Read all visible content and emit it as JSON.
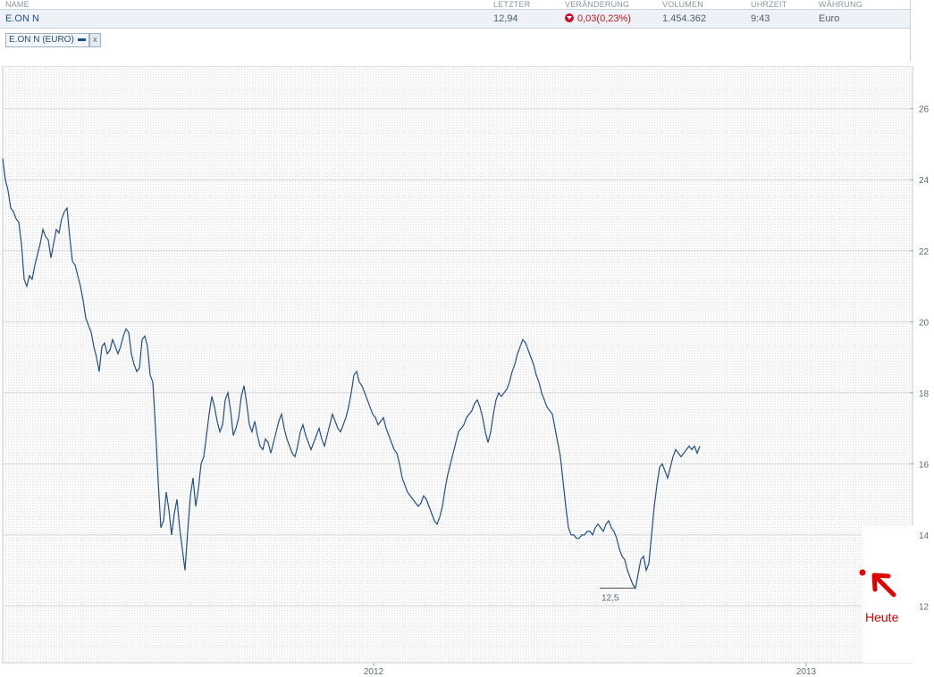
{
  "quote": {
    "headers": {
      "name": "NAME",
      "last": "LETZTER",
      "change": "VERÄNDERUNG",
      "volume": "VOLUMEN",
      "time": "UHRZEIT",
      "currency": "WÄHRUNG"
    },
    "row": {
      "name": "E.ON N",
      "last": "12,94",
      "change": "0,03(0,23%)",
      "volume": "1.454.362",
      "time": "9:43",
      "currency": "Euro"
    },
    "colors": {
      "down": "#c8102e",
      "line": "#1f4f8a"
    }
  },
  "filter": {
    "series_tag": "E.ON N (EURO)",
    "close_symbol": "x"
  },
  "annotation": {
    "text": "Heute"
  },
  "chart_data": {
    "type": "line",
    "y_ticks": [
      "26",
      "24",
      "22",
      "20",
      "18",
      "16",
      "14",
      "12"
    ],
    "x_ticks": [
      "2012",
      "2013"
    ],
    "ylim": [
      10.4,
      27.2
    ],
    "y_min_label": "12,5",
    "series": [
      {
        "x_index": [
          0,
          3,
          6,
          9,
          12,
          15,
          18,
          21,
          24,
          27,
          30,
          33,
          36,
          39,
          42,
          45,
          48,
          51,
          54,
          57,
          60,
          63,
          66,
          69,
          72,
          75,
          78,
          81,
          84,
          87,
          90,
          93,
          96,
          99,
          102,
          105,
          108,
          111,
          114,
          117,
          120,
          123,
          126,
          129,
          132,
          135,
          138,
          141,
          144,
          147,
          150,
          153,
          156,
          159,
          162,
          165,
          168,
          171,
          174,
          177,
          180,
          183,
          186,
          189,
          192,
          195,
          198,
          201,
          204,
          207,
          210,
          213,
          216,
          219,
          222,
          225,
          228,
          231,
          234,
          237,
          240,
          243,
          246,
          249,
          252,
          255,
          258,
          261,
          264,
          267,
          270,
          273,
          276,
          279,
          282,
          285,
          288,
          291,
          294,
          297,
          300,
          303,
          306,
          309,
          312,
          315,
          318,
          321,
          324,
          327,
          330,
          333,
          336,
          339,
          342,
          345,
          348,
          351,
          354,
          357,
          360,
          363,
          366,
          369,
          372,
          375,
          378,
          381,
          384,
          387,
          390,
          393,
          396,
          399,
          402,
          405,
          408,
          411,
          414,
          417,
          420,
          423,
          426,
          429,
          432,
          435,
          438,
          441,
          444,
          447,
          450,
          453,
          456,
          459,
          462,
          465,
          468,
          471,
          474,
          477,
          480,
          483,
          486,
          489,
          492,
          495,
          498,
          501,
          504,
          507,
          510,
          513,
          516,
          519,
          522,
          525,
          528,
          531,
          534,
          537,
          540,
          543,
          546,
          549,
          552,
          555,
          558,
          561,
          564,
          567,
          570,
          573,
          576,
          579,
          582,
          585,
          588,
          591,
          594,
          597,
          600,
          603,
          606,
          609,
          612,
          615,
          618,
          621,
          624,
          627,
          630,
          633,
          636,
          639,
          642,
          645,
          648,
          651,
          654,
          657,
          660,
          663,
          666,
          669,
          672,
          675,
          678,
          681,
          684,
          687,
          690,
          693,
          696,
          699,
          702,
          705,
          708,
          711,
          714,
          717,
          720,
          723,
          726,
          729,
          732,
          735,
          738,
          741,
          744,
          747,
          750,
          753,
          756,
          759,
          762,
          765,
          768,
          771,
          774,
          777,
          780,
          783,
          786,
          789,
          792,
          795,
          798,
          801,
          804,
          807,
          810,
          813,
          816,
          819,
          822,
          825,
          828,
          831,
          834,
          837,
          840,
          843,
          846,
          849,
          852,
          855,
          858,
          861,
          864,
          867,
          870,
          873,
          876,
          879,
          882,
          885,
          888,
          891,
          894,
          897,
          900,
          903,
          906,
          909,
          912,
          915,
          918,
          921,
          924,
          927,
          930,
          933,
          936,
          939,
          942,
          945,
          948,
          951,
          954,
          957,
          960,
          963,
          966,
          969,
          972,
          975,
          978,
          981,
          984,
          987,
          990,
          993,
          996,
          999,
          1002,
          1005,
          1008,
          1011
        ],
        "values": [
          24.6,
          24.0,
          23.7,
          23.2,
          23.1,
          22.9,
          22.8,
          22.2,
          21.2,
          21.0,
          21.3,
          21.2,
          21.6,
          21.9,
          22.2,
          22.6,
          22.4,
          22.3,
          21.8,
          22.2,
          22.6,
          22.5,
          22.9,
          23.1,
          23.2,
          22.4,
          21.7,
          21.6,
          21.3,
          21.0,
          20.6,
          20.1,
          19.9,
          19.7,
          19.3,
          19.0,
          18.6,
          19.3,
          19.4,
          19.1,
          19.2,
          19.5,
          19.3,
          19.1,
          19.3,
          19.6,
          19.8,
          19.7,
          19.1,
          18.8,
          18.6,
          18.7,
          19.5,
          19.6,
          19.3,
          18.5,
          18.3,
          17.0,
          15.5,
          14.2,
          14.4,
          15.2,
          14.7,
          14.0,
          14.6,
          15.0,
          14.2,
          13.6,
          13.0,
          14.1,
          15.1,
          15.6,
          14.8,
          15.3,
          16.0,
          16.2,
          16.8,
          17.4,
          17.9,
          17.6,
          17.2,
          16.9,
          17.1,
          17.8,
          18.0,
          17.5,
          16.8,
          17.0,
          17.3,
          17.9,
          18.2,
          17.7,
          17.1,
          16.9,
          17.2,
          16.8,
          16.5,
          16.4,
          16.7,
          16.6,
          16.3,
          16.6,
          16.9,
          17.2,
          17.4,
          17.0,
          16.7,
          16.5,
          16.3,
          16.2,
          16.5,
          16.9,
          17.1,
          16.8,
          16.6,
          16.4,
          16.6,
          16.8,
          17.0,
          16.7,
          16.5,
          16.8,
          17.1,
          17.4,
          17.2,
          17.0,
          16.9,
          17.1,
          17.3,
          17.6,
          18.0,
          18.5,
          18.6,
          18.3,
          18.2,
          18.0,
          17.8,
          17.6,
          17.4,
          17.3,
          17.1,
          17.2,
          17.3,
          17.0,
          16.8,
          16.6,
          16.4,
          16.3,
          16.0,
          15.6,
          15.4,
          15.2,
          15.1,
          15.0,
          14.9,
          14.8,
          14.9,
          15.1,
          15.0,
          14.8,
          14.6,
          14.4,
          14.3,
          14.5,
          14.8,
          15.3,
          15.7,
          16.0,
          16.3,
          16.6,
          16.9,
          17.0,
          17.1,
          17.3,
          17.4,
          17.5,
          17.7,
          17.8,
          17.6,
          17.3,
          16.9,
          16.6,
          16.9,
          17.4,
          17.8,
          18.0,
          17.9,
          18.0,
          18.1,
          18.3,
          18.6,
          18.8,
          19.1,
          19.3,
          19.5,
          19.4,
          19.2,
          19.0,
          18.8,
          18.5,
          18.3,
          18.0,
          17.8,
          17.6,
          17.5,
          17.4,
          17.0,
          16.6,
          16.2,
          15.5,
          14.8,
          14.2,
          14.0,
          14.0,
          13.9,
          13.9,
          14.0,
          14.0,
          14.1,
          14.1,
          14.0,
          14.2,
          14.3,
          14.2,
          14.1,
          14.3,
          14.4,
          14.2,
          14.1,
          13.9,
          13.6,
          13.4,
          13.3,
          13.0,
          12.8,
          12.6,
          12.5,
          12.9,
          13.3,
          13.4,
          13.0,
          13.2,
          14.0,
          14.8,
          15.4,
          15.9,
          16.0,
          15.8,
          15.6,
          15.9,
          16.2,
          16.4,
          16.3,
          16.2,
          16.3,
          16.4,
          16.5,
          16.4,
          16.5,
          16.3,
          16.5
        ]
      }
    ]
  }
}
